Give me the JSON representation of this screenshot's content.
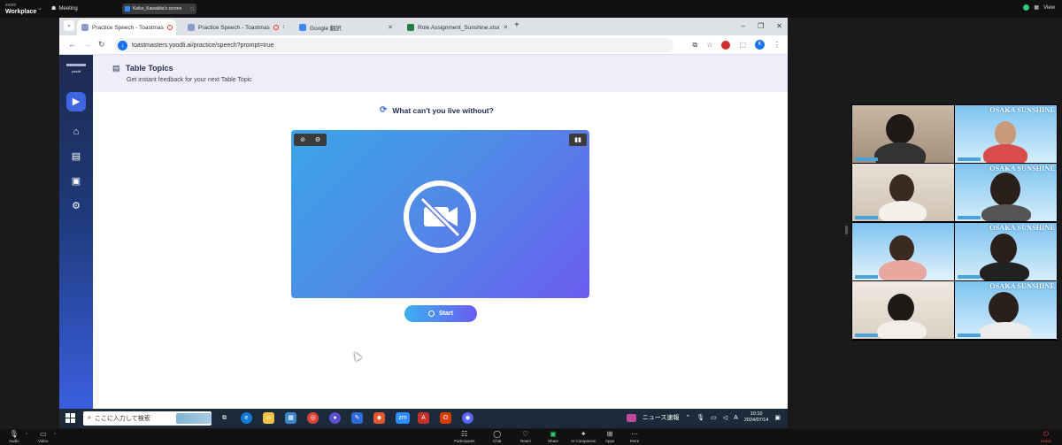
{
  "zoom_top": {
    "brand": "zoom",
    "brand_sub": "Workplace",
    "meeting_label": "Meeting",
    "shared_screen_label": "Keiko_Kawakita's screen",
    "view_label": "View"
  },
  "browser": {
    "tabs": [
      {
        "label": "Practice Speech - Toastmas",
        "favicon_color": "#8a9cc7"
      },
      {
        "label": "Practice Speech - Toastmas",
        "favicon_color": "#8a9cc7"
      },
      {
        "label": "Google 翻訳",
        "favicon_color": "#4285f4"
      },
      {
        "label": "Role Assignment_Sunshine.xlsx",
        "favicon_color": "#1e7e45"
      }
    ],
    "url": "toastmasters.yoodli.ai/practice/speech?prompt=true",
    "profile_initial": "K"
  },
  "app": {
    "logo_text": "yoodli",
    "header_title": "Table Topics",
    "header_subtitle": "Get instant feedback for your next Table Topic",
    "prompt": "What can't you live without?",
    "start_label": "Start",
    "sidebar_icons": [
      "video-icon",
      "home-icon",
      "chart-icon",
      "play-library-icon",
      "settings-group-icon"
    ]
  },
  "taskbar": {
    "search_placeholder": "ここに入力して検索",
    "news_label": "ニュース速報",
    "ime_label": "A",
    "time": "10:10",
    "date": "2024/07/14"
  },
  "gallery": {
    "banner_text": "OSAKA SUNSHINE"
  },
  "zoom_bottom": {
    "items": [
      "Audio",
      "Video",
      "Participants",
      "Chat",
      "React",
      "Share",
      "AI Companion",
      "Apps",
      "More"
    ],
    "leave_label": "Leave"
  },
  "colors": {
    "sidebar": "#1f2a4f",
    "accent": "#3f66e0",
    "video_gradient_start": "#3aa5e8",
    "video_gradient_end": "#6b5cf0"
  }
}
